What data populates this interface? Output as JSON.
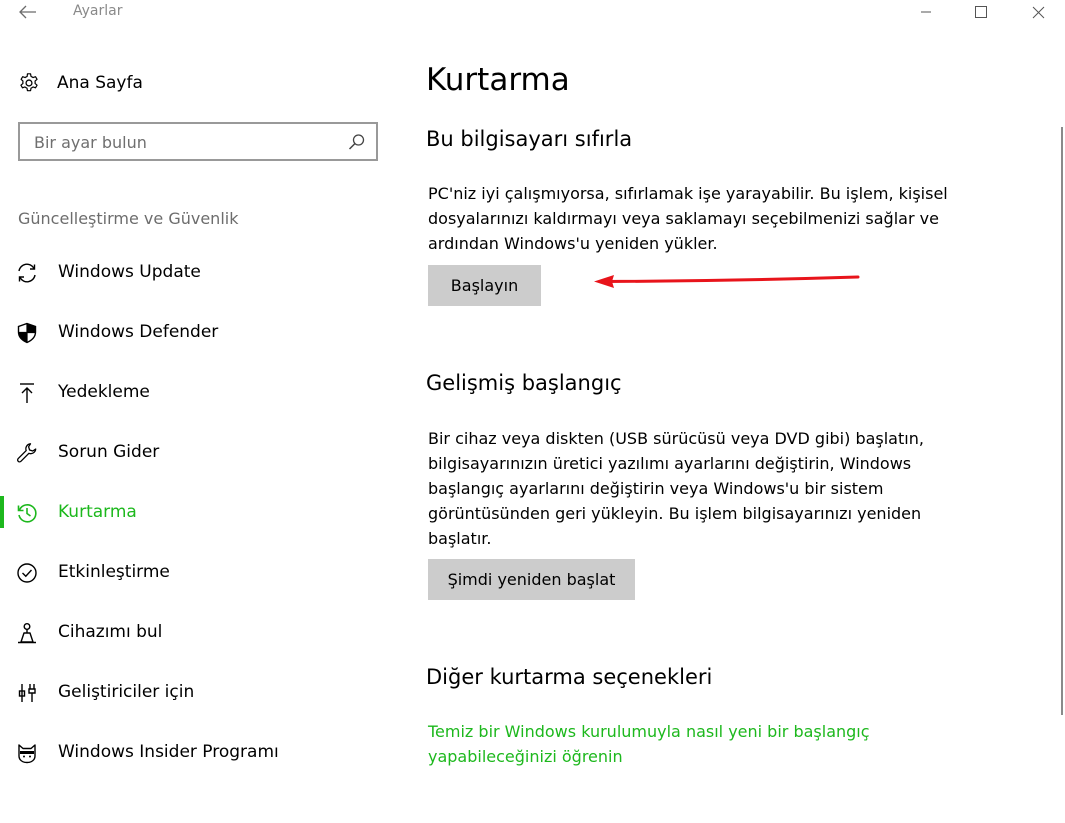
{
  "window": {
    "title": "Ayarlar"
  },
  "sidebar": {
    "home_label": "Ana Sayfa",
    "search_placeholder": "Bir ayar bulun",
    "section_label": "Güncelleştirme ve Güvenlik",
    "items": [
      {
        "label": "Windows Update",
        "icon": "refresh-icon"
      },
      {
        "label": "Windows Defender",
        "icon": "shield-icon"
      },
      {
        "label": "Yedekleme",
        "icon": "backup-arrow-icon"
      },
      {
        "label": "Sorun Gider",
        "icon": "wrench-icon"
      },
      {
        "label": "Kurtarma",
        "icon": "history-icon",
        "active": true
      },
      {
        "label": "Etkinleştirme",
        "icon": "check-circle-icon"
      },
      {
        "label": "Cihazımı bul",
        "icon": "location-person-icon"
      },
      {
        "label": "Geliştiriciler için",
        "icon": "developer-tools-icon"
      },
      {
        "label": "Windows Insider Programı",
        "icon": "ninja-cat-icon"
      }
    ]
  },
  "main": {
    "page_title": "Kurtarma",
    "reset": {
      "heading": "Bu bilgisayarı sıfırla",
      "description": "PC'niz iyi çalışmıyorsa, sıfırlamak işe yarayabilir. Bu işlem, kişisel dosyalarınızı kaldırmayı veya saklamayı seçebilmenizi sağlar ve ardından Windows'u yeniden yükler.",
      "button": "Başlayın"
    },
    "advanced": {
      "heading": "Gelişmiş başlangıç",
      "description": "Bir cihaz veya diskten (USB sürücüsü veya DVD gibi) başlatın, bilgisayarınızın üretici yazılımı ayarlarını değiştirin, Windows başlangıç ayarlarını değiştirin veya Windows'u bir sistem görüntüsünden geri yükleyin. Bu işlem bilgisayarınızı yeniden başlatır.",
      "button": "Şimdi yeniden başlat"
    },
    "other": {
      "heading": "Diğer kurtarma seçenekleri",
      "link": "Temiz bir Windows kurulumuyla nasıl yeni bir başlangıç yapabileceğinizi öğrenin"
    }
  },
  "colors": {
    "accent": "#1db81d",
    "button_bg": "#cccccc",
    "annotation_arrow": "#e8141b"
  }
}
